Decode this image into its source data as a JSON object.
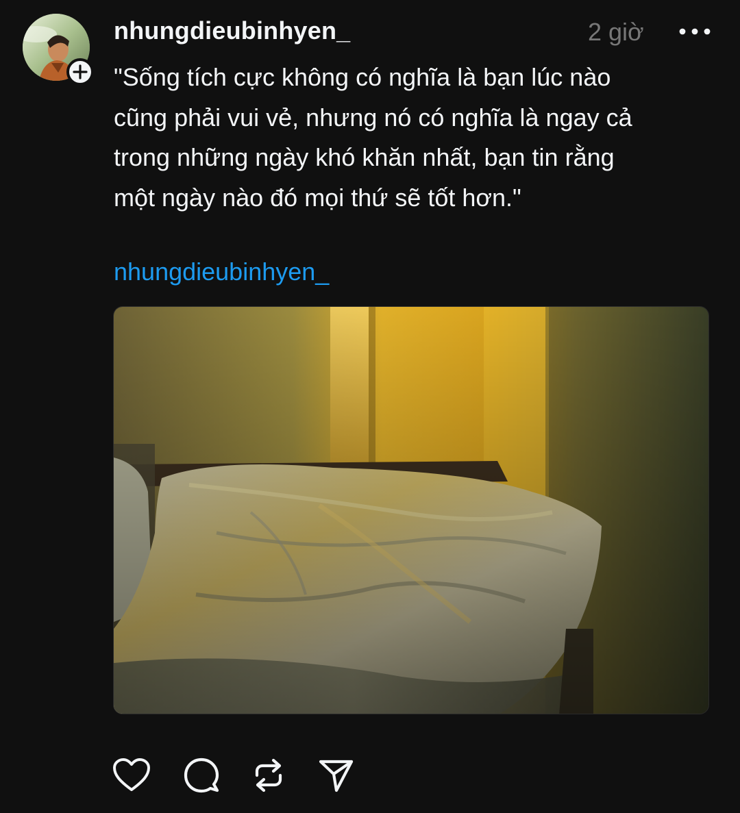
{
  "post": {
    "username": "nhungdieubinhyen_",
    "timestamp": "2 giờ",
    "caption": "\"Sống tích cực không có nghĩa là bạn lúc nào\ncũng phải vui vẻ, nhưng nó có nghĩa là ngay cả\ntrong những ngày khó khăn nhất, bạn tin rằng\nmột ngày nào đó mọi thứ sẽ tốt hơn.\"",
    "mention": "nhungdieubinhyen_",
    "photo_subject": "bed-pillows-in-sunlight-photo",
    "avatar_icon": "profile-avatar",
    "follow_icon": "plus-icon",
    "more_icon": "ellipsis-icon"
  },
  "actions": [
    {
      "name": "like",
      "icon": "heart-icon"
    },
    {
      "name": "reply",
      "icon": "comment-bubble-icon"
    },
    {
      "name": "repost",
      "icon": "repost-arrows-icon"
    },
    {
      "name": "share",
      "icon": "send-paper-plane-icon"
    }
  ],
  "colors": {
    "background": "#101010",
    "text": "#f3f5f7",
    "muted": "#777777",
    "link": "#1d9bf0"
  }
}
